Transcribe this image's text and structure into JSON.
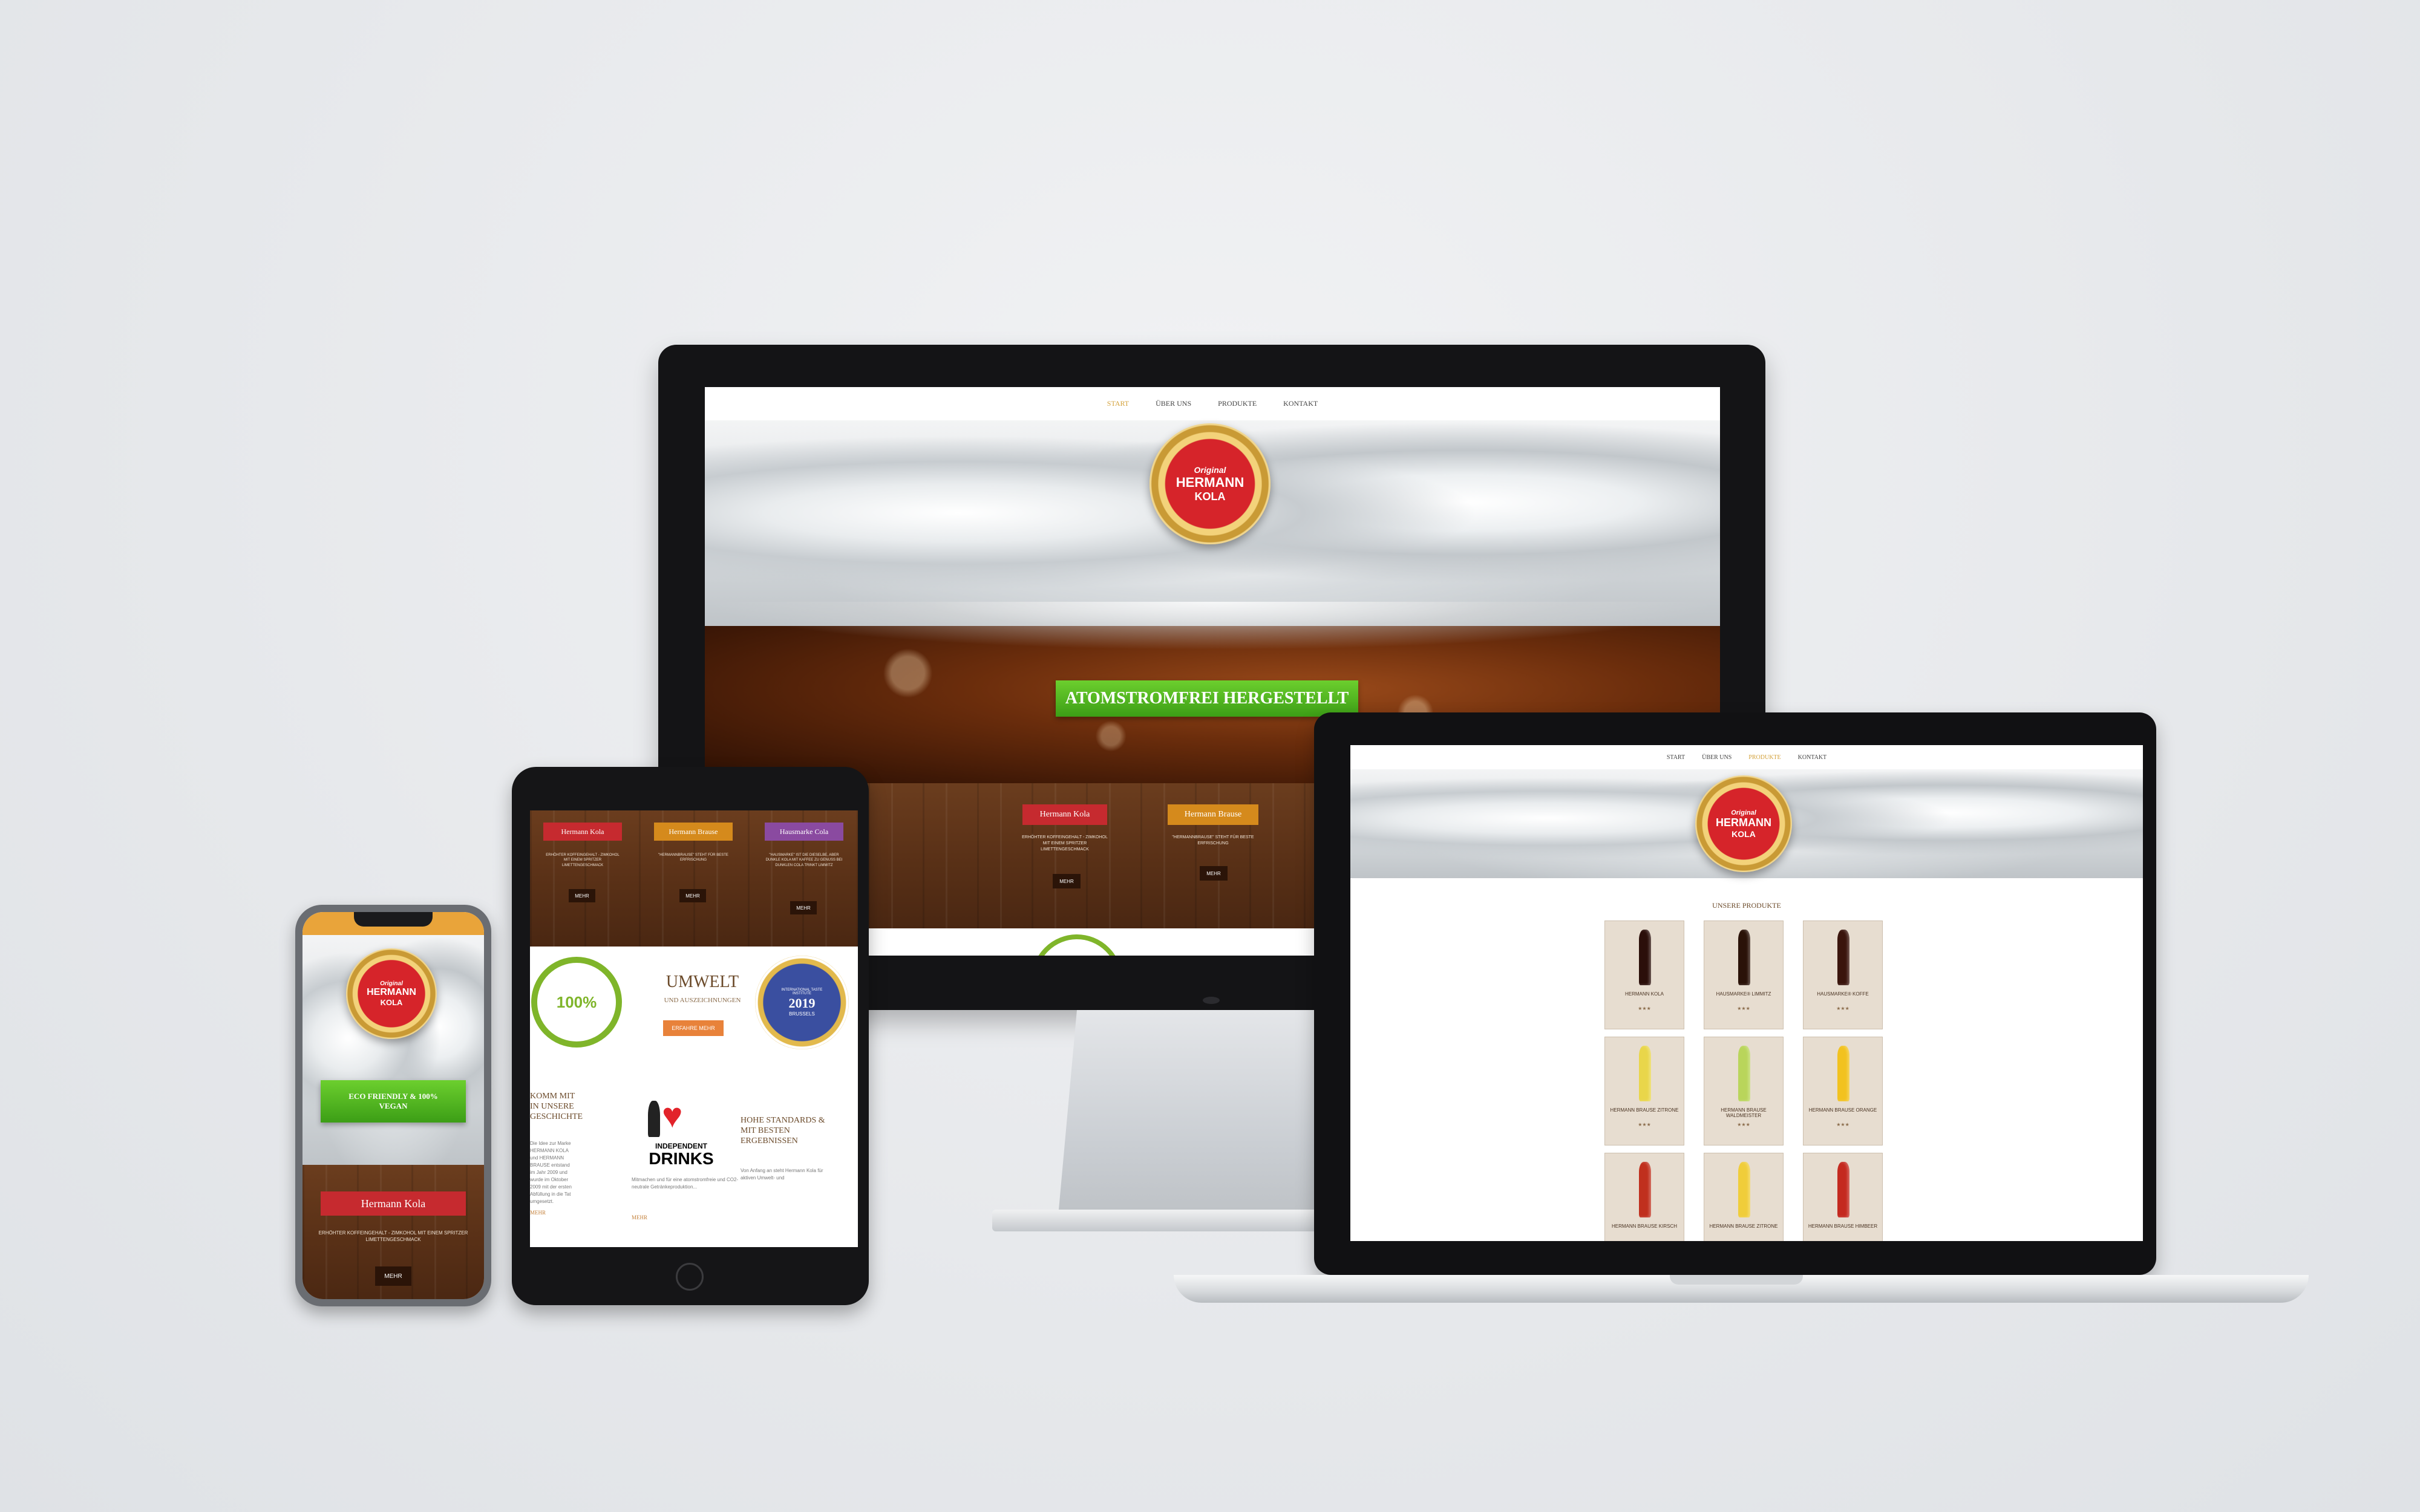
{
  "site": {
    "nav": [
      "START",
      "ÜBER UNS",
      "PRODUKTE",
      "KONTAKT"
    ],
    "logo_top": "Original",
    "logo_main": "HERMANN",
    "logo_sub": "KOLA"
  },
  "monitor": {
    "ribbon": "ATOMSTROMFREI HERGESTELLT",
    "products": [
      {
        "label": "Hermann Kola",
        "text": "ERHÖHTER KOFFEINGEHALT - ZIMKOHOL MIT EINEM SPRITZER LIMETTENGESCHMACK",
        "button": "MEHR",
        "color": "#c62a2f"
      },
      {
        "label": "Hermann Brause",
        "text": "\"HERMANNBRAUSE\" STEHT FÜR BESTE ERFRISCHUNG",
        "button": "MEHR",
        "color": "#d58a1c"
      }
    ]
  },
  "tablet": {
    "products": [
      {
        "label": "Hermann Kola",
        "text": "ERHÖHTER KOFFEINGEHALT - ZIMKOHOL MIT EINEM SPRITZER LIMETTENGESCHMACK",
        "button": "MEHR",
        "color": "#c62a2f"
      },
      {
        "label": "Hermann Brause",
        "text": "\"HERMANNBRAUSE\" STEHT FÜR BESTE ERFRISCHUNG",
        "button": "MEHR",
        "color": "#d58a1c"
      },
      {
        "label": "Hausmarke Cola",
        "text": "\"HAUSMARKE\" IST DIE DIESELBE, ABER DUNKLE KOLA MIT KAFFEE ZU GENUSS BEI DUNKLEN COLA TRINKT LIMMITZ",
        "button": "MEHR",
        "color": "#8a4aa0"
      }
    ],
    "eco_mark": "100%",
    "umwelt_title": "UMWELT",
    "umwelt_sub": "UND AUSZEICHNUNGEN",
    "umwelt_button": "ERFAHRE MEHR",
    "seal_top": "INTERNATIONAL TASTE INSTITUTE",
    "seal_year": "2019",
    "seal_bottom": "BRUSSELS",
    "story_title": "KOMM MIT IN UNSERE GESCHICHTE",
    "story_text": "Die Idee zur Marke HERMANN KOLA und HERMANN BRAUSE entstand im Jahr 2009 und wurde im Oktober 2009 mit der ersten Abfüllung in die Tat umgesetzt.",
    "story_more": "MEHR",
    "indie_label": "INDEPENDENT",
    "indie_big": "DRINKS",
    "indie_text": "Mitmachen und für eine atomstromfreie und CO2-neutrale Getränkeproduktion...",
    "indie_more": "MEHR",
    "standards_title": "HOHE STANDARDS & MIT BESTEN ERGEBNISSEN",
    "standards_text": "Von Anfang an steht Hermann Kola für aktiven Umwelt- und"
  },
  "phone": {
    "ribbon": "ECO FRIENDLY & 100% VEGAN",
    "product_label": "Hermann Kola",
    "product_text": "ERHÖHTER KOFFEINGEHALT - ZIMKOHOL MIT EINEM SPRITZER LIMETTENGESCHMACK",
    "button": "MEHR"
  },
  "laptop": {
    "section_title": "UNSERE PRODUKTE",
    "products": [
      {
        "name": "HERMANN KOLA",
        "bottle": "#2b0f0a",
        "stars": "★★★"
      },
      {
        "name": "HAUSMARKE® LIMMITZ",
        "bottle": "#2a1208",
        "stars": "★★★"
      },
      {
        "name": "HAUSMARKE® KOFFE",
        "bottle": "#3a140c",
        "stars": "★★★"
      },
      {
        "name": "HERMANN BRAUSE ZITRONE",
        "bottle": "#e9d64a",
        "stars": "★★★"
      },
      {
        "name": "HERMANN BRAUSE WALDMEISTER",
        "bottle": "#b9d55b",
        "stars": "★★★"
      },
      {
        "name": "HERMANN BRAUSE ORANGE",
        "bottle": "#f2c21f",
        "stars": "★★★"
      },
      {
        "name": "HERMANN BRAUSE KIRSCH",
        "bottle": "#c0301e",
        "stars": ""
      },
      {
        "name": "HERMANN BRAUSE ZITRONE",
        "bottle": "#f0cd3a",
        "stars": ""
      },
      {
        "name": "HERMANN BRAUSE HIMBEER",
        "bottle": "#c4291f",
        "stars": ""
      }
    ]
  }
}
